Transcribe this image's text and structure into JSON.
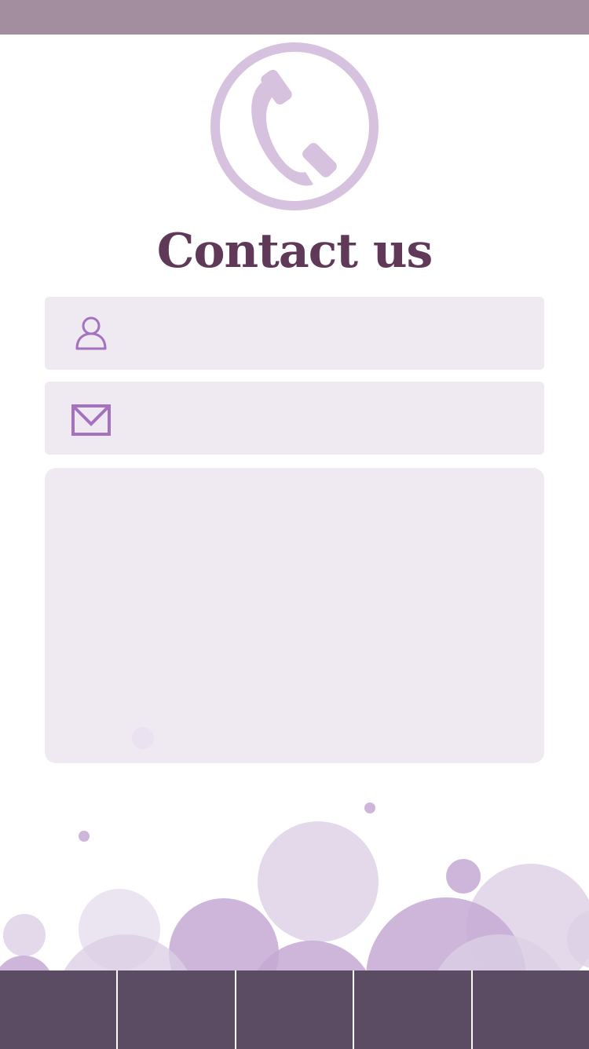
{
  "header": {
    "title": "Contact us"
  },
  "logo": {
    "icon": "phone-icon"
  },
  "form": {
    "name": {
      "icon": "person-icon",
      "value": "",
      "placeholder": ""
    },
    "email": {
      "icon": "envelope-icon",
      "value": "",
      "placeholder": ""
    },
    "message": {
      "value": "",
      "placeholder": ""
    }
  },
  "bottom_nav": {
    "tabs": [
      {
        "label": ""
      },
      {
        "label": ""
      },
      {
        "label": ""
      },
      {
        "label": ""
      },
      {
        "label": ""
      }
    ]
  },
  "colors": {
    "status_bar": "#a38ea0",
    "accent_light": "#d6c2df",
    "accent_icon": "#a472bf",
    "title": "#5f3957",
    "field_bg": "#efe9f2",
    "nav_bg": "#5b4c63",
    "bubble_dark": "#c4a9d4",
    "bubble_mid": "#dccfe5",
    "bubble_light": "#e9e1ef"
  }
}
